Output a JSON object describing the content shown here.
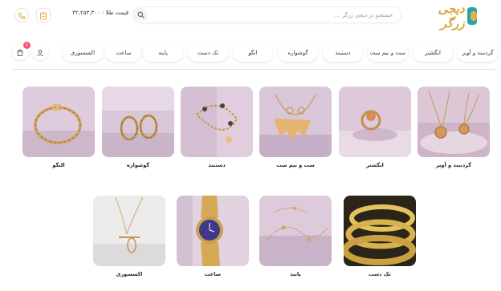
{
  "header": {
    "logo_text": "دیجی زرگر",
    "search_placeholder": "جستجو در دیجی زرگر ...",
    "gold_price": "قیمت طلا : ۳۲,۲۵۳,۳۰۰",
    "icons": [
      "logo-icon",
      "search-icon",
      "document-icon",
      "phone-icon"
    ]
  },
  "nav": {
    "items": [
      "گردنبند و آویز",
      "انگشتر",
      "ست و نیم ست",
      "دستبند",
      "گوشواره",
      "انگو",
      "تک دست",
      "پابند",
      "ساعت",
      "اکسسوری"
    ],
    "cart_count": "0",
    "icons": [
      "user-icon",
      "cart-icon"
    ]
  },
  "categories": [
    {
      "label": "گردنبند و آویز"
    },
    {
      "label": "انگشتر"
    },
    {
      "label": "ست و نیم ست"
    },
    {
      "label": "دستبند"
    },
    {
      "label": "گوشواره"
    },
    {
      "label": "النگو"
    },
    {
      "label": "تک دست"
    },
    {
      "label": "پابند"
    },
    {
      "label": "ساعت"
    },
    {
      "label": "اکسسوری"
    }
  ],
  "colors": {
    "brand_teal": "#2aa6a8",
    "brand_gold": "#d9a53f",
    "badge": "#ff4a6e",
    "tile_bg": "#d9c9dc"
  }
}
